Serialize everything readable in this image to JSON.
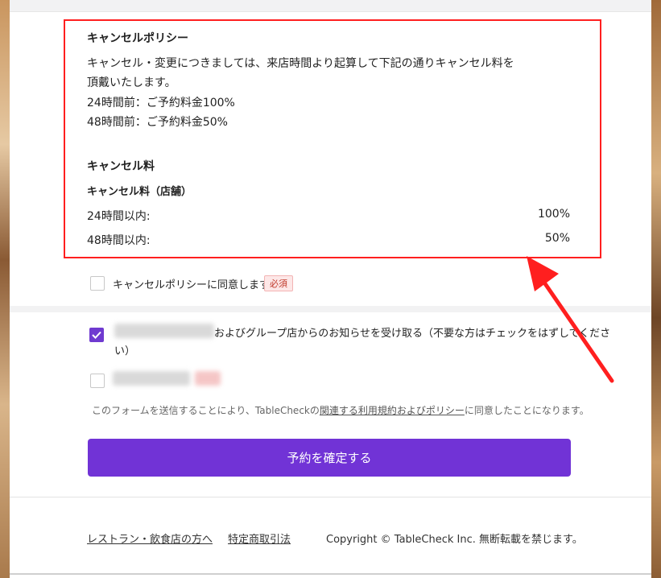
{
  "policy": {
    "title": "キャンセルポリシー",
    "text_line1": "キャンセル・変更につきましては、来店時間より起算して下記の通りキャンセル料を",
    "text_line2": "頂戴いたします。",
    "line_24h": "24時間前：ご予約料金100%",
    "line_48h": "48時間前：ご予約料金50%"
  },
  "fee": {
    "title": "キャンセル料",
    "subtitle": "キャンセル料（店舗）",
    "rows": [
      {
        "label": "24時間以内:",
        "value": "100%"
      },
      {
        "label": "48時間以内:",
        "value": "50%"
      }
    ]
  },
  "agree": {
    "label": "キャンセルポリシーに同意します。",
    "badge": "必須",
    "checked": false
  },
  "newsletter": {
    "label_line1": "およびグループ店からのお知らせを受け取る（不要な方はチェックをはずしてくださ",
    "label_line2": "い）",
    "checked": true
  },
  "terms": {
    "prefix": "このフォームを送信することにより、TableCheckの",
    "link": "関連する利用規約およびポリシー",
    "suffix": "に同意したことになります。"
  },
  "submit_label": "予約を確定する",
  "footer": {
    "link_restaurant": "レストラン・飲食店の方へ",
    "link_commerce": "特定商取引法",
    "copyright": "Copyright © TableCheck Inc. 無断転載を禁じます。"
  },
  "colors": {
    "accent": "#7133d6",
    "annotation": "#ff1f1f"
  }
}
